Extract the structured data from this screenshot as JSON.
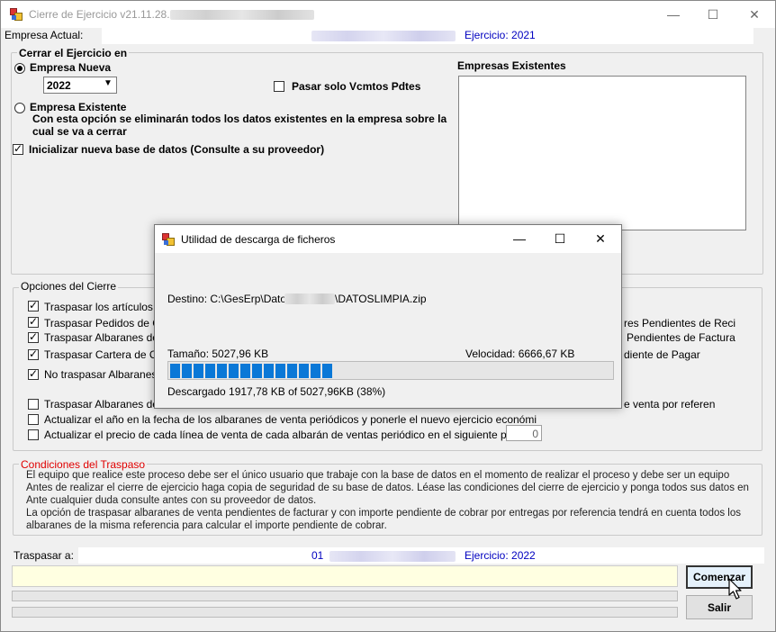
{
  "window": {
    "title": "Cierre de Ejercicio v21.11.28.0",
    "minimize_glyph": "—",
    "maximize_glyph": "☐",
    "close_glyph": "✕"
  },
  "header": {
    "empresa_actual_label": "Empresa Actual:",
    "ejercicio_actual": "Ejercicio: 2021"
  },
  "cerrar_group": {
    "legend": "Cerrar el Ejercicio en",
    "radio_nueva_label": "Empresa Nueva",
    "year_value": "2022",
    "radio_existente_label": "Empresa Existente",
    "existente_note": "Con esta opción se eliminarán todos los datos existentes en la empresa sobre la cual se va a cerrar",
    "pasar_vcmtos_label": "Pasar solo Vcmtos Pdtes",
    "inicializar_label": "Inicializar nueva base de datos (Consulte a su proveedor)",
    "empresas_existentes_label": "Empresas Existentes"
  },
  "opciones_group": {
    "legend": "Opciones del Cierre",
    "options": [
      {
        "label": "Traspasar los artículos n",
        "checked": true
      },
      {
        "label": "Traspasar Pedidos de Cl",
        "checked": true
      },
      {
        "label": "Traspasar Albaranes de",
        "checked": true
      },
      {
        "label": "Traspasar Cartera de Co",
        "checked": true
      },
      {
        "label": "No traspasar Albaranes d",
        "checked": true
      },
      {
        "label": "Traspasar Albaranes de",
        "checked": false
      },
      {
        "label": "Actualizar el año en la fecha de los albaranes de venta periódicos y ponerle el nuevo ejercicio económi",
        "checked": false
      },
      {
        "label": "Actualizar el precio de cada línea de venta de cada albarán de ventas periódico en el siguiente porce",
        "checked": false
      }
    ],
    "right_texts": [
      "res Pendientes de Reci",
      "Pendientes de Factura",
      "diente de Pagar",
      "e venta por referen"
    ],
    "percent_value": "0"
  },
  "condiciones": {
    "legend": "Condiciones del Traspaso",
    "paragraph1": "El equipo que realice este proceso debe ser el único usuario que trabaje con la base de datos en el momento de realizar el proceso y debe ser un equipo",
    "paragraph2": "Antes de realizar el cierre de ejercicio haga copia de seguridad de su base de datos. Léase las condiciones del cierre de ejercicio y ponga todos sus datos en",
    "paragraph3": "Ante cualquier duda consulte antes con su proveedor de datos.",
    "paragraph4": "La opción de traspasar albaranes de venta pendientes de facturar y con importe pendiente de cobrar por entregas por referencia tendrá en cuenta todos los",
    "paragraph5": "albaranes de la misma referencia para calcular el importe pendiente de cobrar."
  },
  "footer": {
    "traspasar_label": "Traspasar a:",
    "company_code": "01",
    "ejercicio_destino": "Ejercicio: 2022",
    "comenzar_label": "Comenzar",
    "salir_label": "Salir"
  },
  "download_dialog": {
    "title": "Utilidad de descarga de ficheros",
    "destino_prefix": "Destino: C:\\GesErp\\Datos\\",
    "destino_suffix": "\\DATOSLIMPIA.zip",
    "tamano": "Tamaño: 5027,96 KB",
    "velocidad": "Velocidad: 6666,67 KB",
    "descargado": "Descargado 1917,78 KB of 5027,96KB (38%)",
    "progress_percent": 38
  },
  "colors": {
    "accent_blue": "#0000c0",
    "progress_blue": "#0a78d7",
    "condiciones_red": "#e00000",
    "status_yellow": "#ffffe1"
  }
}
